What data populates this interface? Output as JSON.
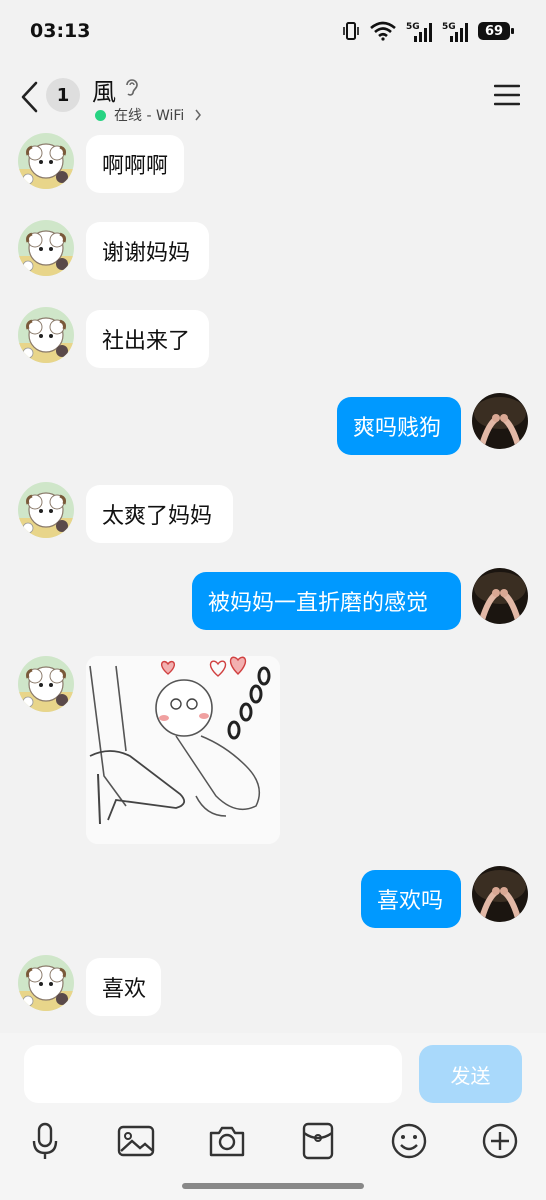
{
  "status_bar": {
    "time": "03:13",
    "battery": "69",
    "network1": "5G",
    "network2": "5G"
  },
  "header": {
    "unread_count": "1",
    "contact_name": "風",
    "status_text": "在线 - WiFi"
  },
  "messages": [
    {
      "side": "in",
      "text": "啊啊啊"
    },
    {
      "side": "in",
      "text": "谢谢妈妈"
    },
    {
      "side": "in",
      "text": "社出来了"
    },
    {
      "side": "out",
      "text": "爽吗贱狗"
    },
    {
      "side": "in",
      "text": "太爽了妈妈"
    },
    {
      "side": "out",
      "text": "被妈妈一直折磨的感觉"
    },
    {
      "side": "in",
      "type": "image"
    },
    {
      "side": "out",
      "text": "喜欢吗"
    },
    {
      "side": "in",
      "text": "喜欢"
    }
  ],
  "input": {
    "value": "",
    "send_label": "发送"
  },
  "toolbar": [
    "microphone-icon",
    "image-icon",
    "camera-icon",
    "red-packet-icon",
    "emoji-icon",
    "plus-icon"
  ],
  "colors": {
    "accent": "#0099ff",
    "online": "#27d382",
    "send_disabled": "#a9d9fb",
    "background": "#f2f2f2"
  }
}
